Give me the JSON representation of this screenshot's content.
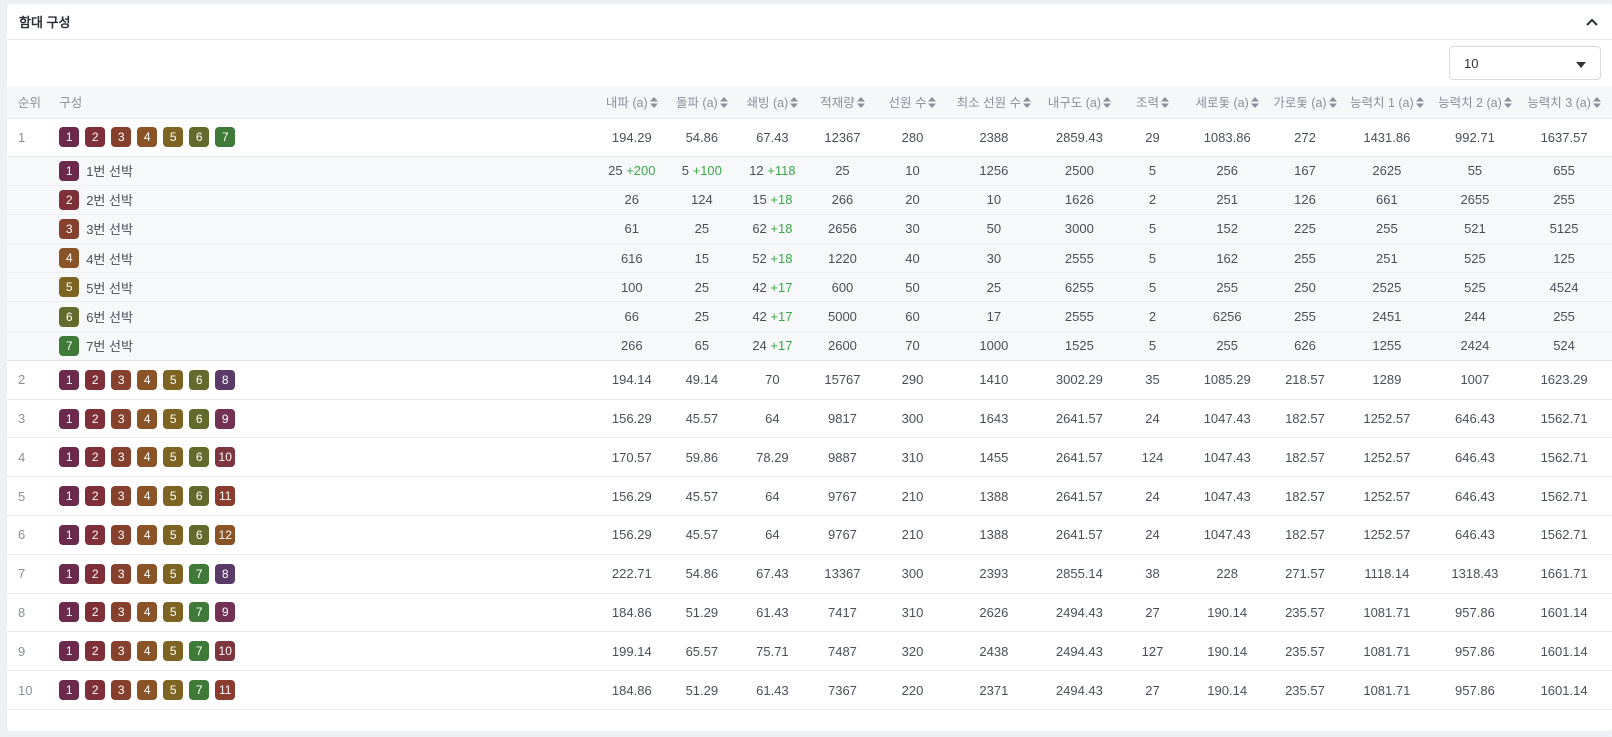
{
  "panel": {
    "title": "함대 구성"
  },
  "page_size": {
    "selected": "10"
  },
  "colors": {
    "1": "#6b2a4c",
    "2": "#7e2f38",
    "3": "#86412e",
    "4": "#8a5426",
    "5": "#7e6422",
    "6": "#626b2b",
    "7": "#3f7a38",
    "8": "#5a3a68",
    "9": "#733154",
    "10": "#7d3540",
    "11": "#8a3c2e",
    "12": "#8a5426"
  },
  "columns": [
    {
      "label": "순위",
      "sortable": false
    },
    {
      "label": "구성",
      "sortable": false
    },
    {
      "label": "내파 (a)",
      "sortable": true
    },
    {
      "label": "돌파 (a)",
      "sortable": true
    },
    {
      "label": "쇄빙 (a)",
      "sortable": true
    },
    {
      "label": "적재량",
      "sortable": true
    },
    {
      "label": "선원 수",
      "sortable": true
    },
    {
      "label": "최소 선원 수",
      "sortable": true
    },
    {
      "label": "내구도 (a)",
      "sortable": true
    },
    {
      "label": "조력",
      "sortable": true
    },
    {
      "label": "세로돛 (a)",
      "sortable": true
    },
    {
      "label": "가로돛 (a)",
      "sortable": true
    },
    {
      "label": "능력치 1 (a)",
      "sortable": true
    },
    {
      "label": "능력치 2 (a)",
      "sortable": true
    },
    {
      "label": "능력치 3 (a)",
      "sortable": true
    }
  ],
  "rows": [
    {
      "rank": "1",
      "ships": [
        "1",
        "2",
        "3",
        "4",
        "5",
        "6",
        "7"
      ],
      "values": [
        "194.29",
        "54.86",
        "67.43",
        "12367",
        "280",
        "2388",
        "2859.43",
        "29",
        "1083.86",
        "272",
        "1431.86",
        "992.71",
        "1637.57"
      ],
      "details": [
        {
          "badge": "1",
          "name": "1번 선박",
          "values": [
            [
              "25",
              "+200"
            ],
            [
              "5",
              "+100"
            ],
            [
              "12",
              "+118"
            ],
            [
              "25",
              ""
            ],
            [
              "10",
              ""
            ],
            [
              "1256",
              ""
            ],
            [
              "2500",
              ""
            ],
            [
              "5",
              ""
            ],
            [
              "256",
              ""
            ],
            [
              "167",
              ""
            ],
            [
              "2625",
              ""
            ],
            [
              "55",
              ""
            ],
            [
              "655",
              ""
            ]
          ]
        },
        {
          "badge": "2",
          "name": "2번 선박",
          "values": [
            [
              "26",
              ""
            ],
            [
              "124",
              ""
            ],
            [
              "15",
              "+18"
            ],
            [
              "266",
              ""
            ],
            [
              "20",
              ""
            ],
            [
              "10",
              ""
            ],
            [
              "1626",
              ""
            ],
            [
              "2",
              ""
            ],
            [
              "251",
              ""
            ],
            [
              "126",
              ""
            ],
            [
              "661",
              ""
            ],
            [
              "2655",
              ""
            ],
            [
              "255",
              ""
            ]
          ]
        },
        {
          "badge": "3",
          "name": "3번 선박",
          "values": [
            [
              "61",
              ""
            ],
            [
              "25",
              ""
            ],
            [
              "62",
              "+18"
            ],
            [
              "2656",
              ""
            ],
            [
              "30",
              ""
            ],
            [
              "50",
              ""
            ],
            [
              "3000",
              ""
            ],
            [
              "5",
              ""
            ],
            [
              "152",
              ""
            ],
            [
              "225",
              ""
            ],
            [
              "255",
              ""
            ],
            [
              "521",
              ""
            ],
            [
              "5125",
              ""
            ]
          ]
        },
        {
          "badge": "4",
          "name": "4번 선박",
          "values": [
            [
              "616",
              ""
            ],
            [
              "15",
              ""
            ],
            [
              "52",
              "+18"
            ],
            [
              "1220",
              ""
            ],
            [
              "40",
              ""
            ],
            [
              "30",
              ""
            ],
            [
              "2555",
              ""
            ],
            [
              "5",
              ""
            ],
            [
              "162",
              ""
            ],
            [
              "255",
              ""
            ],
            [
              "251",
              ""
            ],
            [
              "525",
              ""
            ],
            [
              "125",
              ""
            ]
          ]
        },
        {
          "badge": "5",
          "name": "5번 선박",
          "values": [
            [
              "100",
              ""
            ],
            [
              "25",
              ""
            ],
            [
              "42",
              "+17"
            ],
            [
              "600",
              ""
            ],
            [
              "50",
              ""
            ],
            [
              "25",
              ""
            ],
            [
              "6255",
              ""
            ],
            [
              "5",
              ""
            ],
            [
              "255",
              ""
            ],
            [
              "250",
              ""
            ],
            [
              "2525",
              ""
            ],
            [
              "525",
              ""
            ],
            [
              "4524",
              ""
            ]
          ]
        },
        {
          "badge": "6",
          "name": "6번 선박",
          "values": [
            [
              "66",
              ""
            ],
            [
              "25",
              ""
            ],
            [
              "42",
              "+17"
            ],
            [
              "5000",
              ""
            ],
            [
              "60",
              ""
            ],
            [
              "17",
              ""
            ],
            [
              "2555",
              ""
            ],
            [
              "2",
              ""
            ],
            [
              "6256",
              ""
            ],
            [
              "255",
              ""
            ],
            [
              "2451",
              ""
            ],
            [
              "244",
              ""
            ],
            [
              "255",
              ""
            ]
          ]
        },
        {
          "badge": "7",
          "name": "7번 선박",
          "values": [
            [
              "266",
              ""
            ],
            [
              "65",
              ""
            ],
            [
              "24",
              "+17"
            ],
            [
              "2600",
              ""
            ],
            [
              "70",
              ""
            ],
            [
              "1000",
              ""
            ],
            [
              "1525",
              ""
            ],
            [
              "5",
              ""
            ],
            [
              "255",
              ""
            ],
            [
              "626",
              ""
            ],
            [
              "1255",
              ""
            ],
            [
              "2424",
              ""
            ],
            [
              "524",
              ""
            ]
          ]
        }
      ]
    },
    {
      "rank": "2",
      "ships": [
        "1",
        "2",
        "3",
        "4",
        "5",
        "6",
        "8"
      ],
      "values": [
        "194.14",
        "49.14",
        "70",
        "15767",
        "290",
        "1410",
        "3002.29",
        "35",
        "1085.29",
        "218.57",
        "1289",
        "1007",
        "1623.29"
      ]
    },
    {
      "rank": "3",
      "ships": [
        "1",
        "2",
        "3",
        "4",
        "5",
        "6",
        "9"
      ],
      "values": [
        "156.29",
        "45.57",
        "64",
        "9817",
        "300",
        "1643",
        "2641.57",
        "24",
        "1047.43",
        "182.57",
        "1252.57",
        "646.43",
        "1562.71"
      ]
    },
    {
      "rank": "4",
      "ships": [
        "1",
        "2",
        "3",
        "4",
        "5",
        "6",
        "10"
      ],
      "values": [
        "170.57",
        "59.86",
        "78.29",
        "9887",
        "310",
        "1455",
        "2641.57",
        "124",
        "1047.43",
        "182.57",
        "1252.57",
        "646.43",
        "1562.71"
      ]
    },
    {
      "rank": "5",
      "ships": [
        "1",
        "2",
        "3",
        "4",
        "5",
        "6",
        "11"
      ],
      "values": [
        "156.29",
        "45.57",
        "64",
        "9767",
        "210",
        "1388",
        "2641.57",
        "24",
        "1047.43",
        "182.57",
        "1252.57",
        "646.43",
        "1562.71"
      ]
    },
    {
      "rank": "6",
      "ships": [
        "1",
        "2",
        "3",
        "4",
        "5",
        "6",
        "12"
      ],
      "values": [
        "156.29",
        "45.57",
        "64",
        "9767",
        "210",
        "1388",
        "2641.57",
        "24",
        "1047.43",
        "182.57",
        "1252.57",
        "646.43",
        "1562.71"
      ]
    },
    {
      "rank": "7",
      "ships": [
        "1",
        "2",
        "3",
        "4",
        "5",
        "7",
        "8"
      ],
      "values": [
        "222.71",
        "54.86",
        "67.43",
        "13367",
        "300",
        "2393",
        "2855.14",
        "38",
        "228",
        "271.57",
        "1118.14",
        "1318.43",
        "1661.71"
      ]
    },
    {
      "rank": "8",
      "ships": [
        "1",
        "2",
        "3",
        "4",
        "5",
        "7",
        "9"
      ],
      "values": [
        "184.86",
        "51.29",
        "61.43",
        "7417",
        "310",
        "2626",
        "2494.43",
        "27",
        "190.14",
        "235.57",
        "1081.71",
        "957.86",
        "1601.14"
      ]
    },
    {
      "rank": "9",
      "ships": [
        "1",
        "2",
        "3",
        "4",
        "5",
        "7",
        "10"
      ],
      "values": [
        "199.14",
        "65.57",
        "75.71",
        "7487",
        "320",
        "2438",
        "2494.43",
        "127",
        "190.14",
        "235.57",
        "1081.71",
        "957.86",
        "1601.14"
      ]
    },
    {
      "rank": "10",
      "ships": [
        "1",
        "2",
        "3",
        "4",
        "5",
        "7",
        "11"
      ],
      "values": [
        "184.86",
        "51.29",
        "61.43",
        "7367",
        "220",
        "2371",
        "2494.43",
        "27",
        "190.14",
        "235.57",
        "1081.71",
        "957.86",
        "1601.14"
      ]
    }
  ]
}
